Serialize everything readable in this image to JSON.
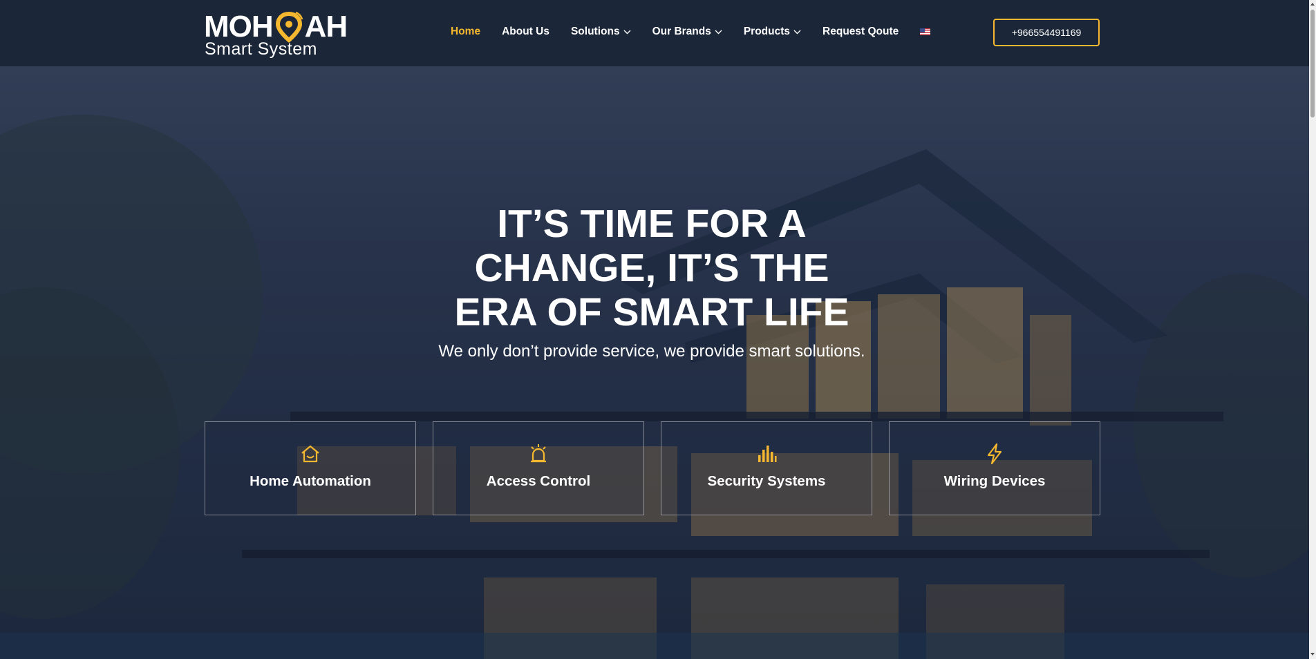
{
  "header": {
    "logo": {
      "part1": "MOH",
      "part2": "AH",
      "subtitle": "Smart System",
      "icon": "map-pin-icon"
    },
    "nav": [
      {
        "label": "Home",
        "active": true,
        "dropdown": false
      },
      {
        "label": "About Us",
        "active": false,
        "dropdown": false
      },
      {
        "label": "Solutions",
        "active": false,
        "dropdown": true
      },
      {
        "label": "Our Brands",
        "active": false,
        "dropdown": true
      },
      {
        "label": "Products",
        "active": false,
        "dropdown": true
      },
      {
        "label": "Request Qoute",
        "active": false,
        "dropdown": false
      }
    ],
    "language_flag": "us-flag-icon",
    "phone_button": "+966554491169"
  },
  "hero": {
    "title_lines": [
      "IT’S TIME FOR A",
      "CHANGE, IT’S THE",
      "ERA OF SMART LIFE"
    ],
    "subtitle": "We only don’t provide service, we provide smart solutions.",
    "cards": [
      {
        "label": "Home Automation",
        "icon": "home-icon"
      },
      {
        "label": "Access Control",
        "icon": "alarm-icon"
      },
      {
        "label": "Security Systems",
        "icon": "bar-chart-icon"
      },
      {
        "label": "Wiring Devices",
        "icon": "lightning-icon"
      }
    ]
  },
  "colors": {
    "header_bg": "#1b2638",
    "accent": "#f6b82f",
    "text": "#ffffff"
  }
}
